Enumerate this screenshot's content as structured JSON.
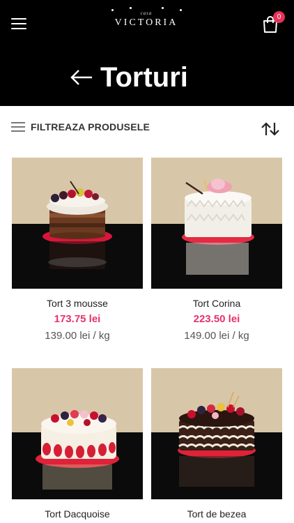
{
  "header": {
    "logo_sub": "casa",
    "logo_main": "VICTORIA",
    "cart_count": "0",
    "page_title": "Torturi"
  },
  "filter": {
    "label": "FILTREAZA PRODUSELE"
  },
  "products": [
    {
      "name": "Tort 3 mousse",
      "price": "173.75 lei",
      "unit_price": "139.00 lei / kg"
    },
    {
      "name": "Tort Corina",
      "price": "223.50 lei",
      "unit_price": "149.00 lei / kg"
    },
    {
      "name": "Tort Dacquoise",
      "price": "",
      "unit_price": ""
    },
    {
      "name": "Tort de bezea",
      "price": "",
      "unit_price": ""
    }
  ],
  "colors": {
    "header_bg": "#000000",
    "accent_price": "#e5336a",
    "badge": "#e8325a"
  },
  "icons": [
    "menu-icon",
    "cart-icon",
    "back-arrow-icon",
    "filter-icon",
    "sort-icon"
  ]
}
